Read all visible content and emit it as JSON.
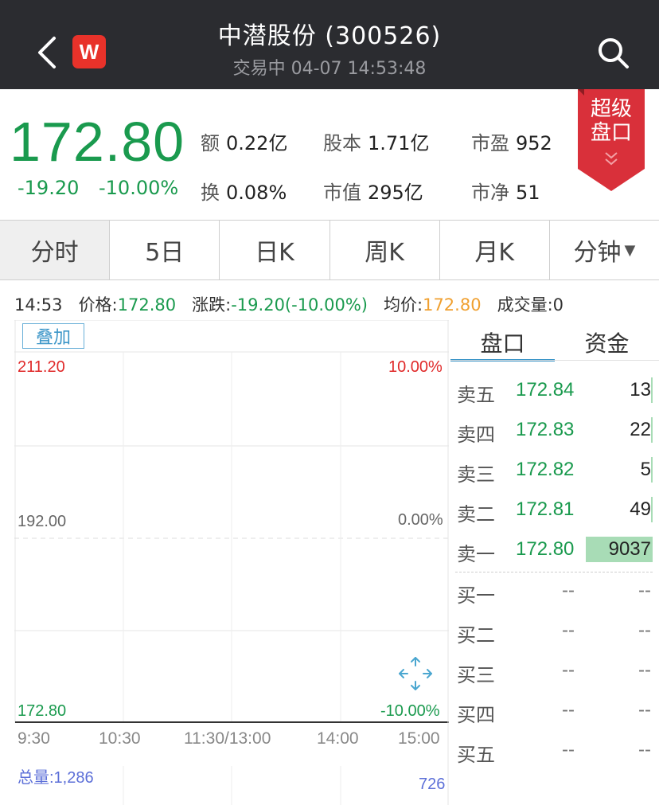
{
  "header": {
    "title": "中潜股份 (300526)",
    "subtitle": "交易中 04-07 14:53:48",
    "badge": "W",
    "back_icon": "chevron-left-icon",
    "search_icon": "search-icon"
  },
  "quote": {
    "price": "172.80",
    "change": "-19.20",
    "change_pct": "-10.00%",
    "metrics": [
      {
        "label": "额",
        "value": "0.22亿"
      },
      {
        "label": "股本",
        "value": "1.71亿"
      },
      {
        "label": "市盈",
        "value": "952"
      },
      {
        "label": "换",
        "value": "0.08%"
      },
      {
        "label": "市值",
        "value": "295亿"
      },
      {
        "label": "市净",
        "value": "51"
      }
    ],
    "deep_book": {
      "line1": "超级",
      "line2": "盘口"
    }
  },
  "tabs": [
    "分时",
    "5日",
    "日K",
    "周K",
    "月K",
    "分钟"
  ],
  "info": {
    "time": "14:53",
    "price_label": "价格:",
    "price": "172.80",
    "change_label": "涨跌:",
    "change": "-19.20(-10.00%)",
    "avg_label": "均价:",
    "avg": "172.80",
    "volume_label": "成交量:",
    "volume": "0"
  },
  "chart": {
    "overlay_btn": "叠加",
    "y_top": "211.20",
    "y_mid": "192.00",
    "y_bottom": "172.80",
    "pct_top": "10.00%",
    "pct_mid": "0.00%",
    "pct_bottom": "-10.00%",
    "times": [
      "9:30",
      "10:30",
      "11:30/13:00",
      "14:00",
      "15:00"
    ],
    "total_volume": "总量:1,286",
    "volume_max": "726"
  },
  "orderbook": {
    "tabs": [
      "盘口",
      "资金"
    ],
    "asks": [
      {
        "label": "卖五",
        "price": "172.84",
        "vol": "13",
        "depth": 0.0014
      },
      {
        "label": "卖四",
        "price": "172.83",
        "vol": "22",
        "depth": 0.0024
      },
      {
        "label": "卖三",
        "price": "172.82",
        "vol": "5",
        "depth": 0.0006
      },
      {
        "label": "卖二",
        "price": "172.81",
        "vol": "49",
        "depth": 0.0054
      },
      {
        "label": "卖一",
        "price": "172.80",
        "vol": "9037",
        "depth": 1.0
      }
    ],
    "bids": [
      {
        "label": "买一",
        "price": "--",
        "vol": "--"
      },
      {
        "label": "买二",
        "price": "--",
        "vol": "--"
      },
      {
        "label": "买三",
        "price": "--",
        "vol": "--"
      },
      {
        "label": "买四",
        "price": "--",
        "vol": "--"
      },
      {
        "label": "买五",
        "price": "--",
        "vol": "--"
      }
    ]
  },
  "colors": {
    "up": "#e02a2a",
    "down": "#1a9a4e",
    "header_bg": "#2b2c30",
    "accent": "#3c96c8"
  }
}
